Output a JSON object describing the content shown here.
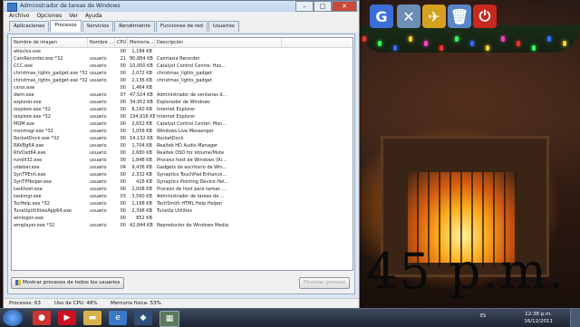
{
  "window": {
    "title": "Administrador de tareas de Windows",
    "menu": [
      "Archivo",
      "Opciones",
      "Ver",
      "Ayuda"
    ],
    "tabs": [
      "Aplicaciones",
      "Procesos",
      "Servicios",
      "Rendimiento",
      "Funciones de red",
      "Usuarios"
    ],
    "active_tab": "Procesos",
    "columns": [
      "Nombre de imagen",
      "Nombre ...",
      "CPU",
      "Memoria ...",
      "Descripción"
    ],
    "processes": [
      [
        "atieclxx.exe",
        "",
        "00",
        "1,184 KB",
        ""
      ],
      [
        "CamRecorder.exe *32",
        "usuario",
        "21",
        "80,884 KB",
        "Camtasia Recorder"
      ],
      [
        "CCC.exe",
        "usuario",
        "00",
        "10,000 KB",
        "Catalyst Control Centre: Hos..."
      ],
      [
        "christmas_lights_gadget.exe *32",
        "usuario",
        "00",
        "2,072 KB",
        "christmas_lights_gadget"
      ],
      [
        "christmas_lights_gadget.exe *32",
        "usuario",
        "00",
        "2,136 KB",
        "christmas_lights_gadget"
      ],
      [
        "csrss.exe",
        "",
        "00",
        "1,464 KB",
        ""
      ],
      [
        "dwm.exe",
        "usuario",
        "07",
        "47,524 KB",
        "Administrador de ventanas d..."
      ],
      [
        "explorer.exe",
        "usuario",
        "00",
        "34,952 KB",
        "Explorador de Windows"
      ],
      [
        "iexplore.exe *32",
        "usuario",
        "00",
        "8,160 KB",
        "Internet Explorer"
      ],
      [
        "iexplore.exe *32",
        "usuario",
        "00",
        "194,916 KB",
        "Internet Explorer"
      ],
      [
        "MOM.exe",
        "usuario",
        "00",
        "2,652 KB",
        "Catalyst Control Center: Mon..."
      ],
      [
        "msnmsgr.exe *32",
        "usuario",
        "00",
        "3,056 KB",
        "Windows Live Messenger"
      ],
      [
        "RocketDock.exe *32",
        "usuario",
        "00",
        "14,132 KB",
        "RocketDock"
      ],
      [
        "RAVBg64.exe",
        "usuario",
        "00",
        "1,704 KB",
        "Realtek HD Audio Manager"
      ],
      [
        "RtVOsd64.exe",
        "usuario",
        "00",
        "2,680 KB",
        "Realtek OSD for Volume/Mute"
      ],
      [
        "rundll32.exe",
        "usuario",
        "00",
        "1,848 KB",
        "Proceso host de Windows (Ri..."
      ],
      [
        "sidebar.exe",
        "usuario",
        "04",
        "9,436 KB",
        "Gadgets de escritorio de Win..."
      ],
      [
        "SynTPEnh.exe",
        "usuario",
        "00",
        "2,332 KB",
        "Synaptics TouchPad Enhance..."
      ],
      [
        "SynTPHelper.exe",
        "usuario",
        "00",
        "416 KB",
        "Synaptics Pointing Device Hel..."
      ],
      [
        "taskhost.exe",
        "usuario",
        "00",
        "2,008 KB",
        "Proceso de host para tareas ..."
      ],
      [
        "taskmgr.exe",
        "usuario",
        "03",
        "3,560 KB",
        "Administrador de tareas de ..."
      ],
      [
        "TscHelp.exe *32",
        "usuario",
        "00",
        "1,168 KB",
        "TechSmith HTML Help Helper"
      ],
      [
        "TuneUpUtilitiesApp64.exe",
        "usuario",
        "00",
        "2,396 KB",
        "TuneUp Utilities"
      ],
      [
        "winlogon.exe",
        "",
        "00",
        "852 KB",
        ""
      ],
      [
        "wmplayer.exe *32",
        "usuario",
        "00",
        "42,844 KB",
        "Reproductor de Windows Media"
      ]
    ],
    "show_all_button": "Mostrar procesos de todos los usuarios",
    "end_process_button": "Finalizar proceso",
    "status": {
      "processes": "Procesos: 63",
      "cpu": "Uso de CPU: 48%",
      "memory": "Memoria física: 53%"
    }
  },
  "desktop": {
    "overlay_text": "45 p.m.",
    "gadgets": [
      {
        "icon": "google-icon",
        "glyph": "G",
        "color": "#3b6fd8"
      },
      {
        "icon": "flag-icon",
        "glyph": "✕",
        "color": "#6d8fb5"
      },
      {
        "icon": "bird-icon",
        "glyph": "✈",
        "color": "#d4a020"
      },
      {
        "icon": "recycle-bin-icon",
        "glyph": "🗑",
        "color": "#5a86c8"
      },
      {
        "icon": "power-icon",
        "glyph": "⏻",
        "color": "#c8281e"
      }
    ]
  },
  "taskbar": {
    "language": "ES",
    "time": "12:38 p.m.",
    "date": "16/12/2011"
  }
}
